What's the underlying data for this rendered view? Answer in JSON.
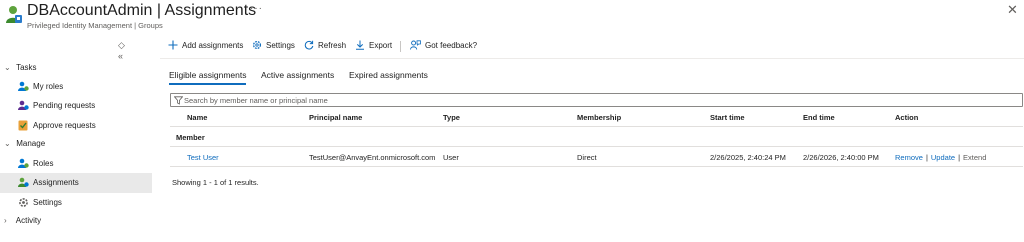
{
  "header": {
    "title": "DBAccountAdmin | Assignments",
    "subtitle": "Privileged Identity Management | Groups",
    "more": "···",
    "close": "✕"
  },
  "sidebar": {
    "controls": {
      "updown": "◇",
      "collapse": "«"
    },
    "groups": [
      {
        "label": "Tasks",
        "expanded": true
      },
      {
        "label": "Manage",
        "expanded": true
      },
      {
        "label": "Activity",
        "expanded": false
      }
    ],
    "items": [
      {
        "label": "My roles",
        "icon": "person-roles-icon"
      },
      {
        "label": "Pending requests",
        "icon": "people-pending-icon"
      },
      {
        "label": "Approve requests",
        "icon": "approve-check-icon"
      },
      {
        "label": "Roles",
        "icon": "people-roles-icon"
      },
      {
        "label": "Assignments",
        "icon": "people-assignments-icon",
        "active": true
      },
      {
        "label": "Settings",
        "icon": "gear-icon"
      }
    ]
  },
  "toolbar": {
    "add": "Add assignments",
    "settings": "Settings",
    "refresh": "Refresh",
    "export": "Export",
    "feedback": "Got feedback?"
  },
  "tabs": [
    {
      "label": "Eligible assignments",
      "active": true
    },
    {
      "label": "Active assignments",
      "active": false
    },
    {
      "label": "Expired assignments",
      "active": false
    }
  ],
  "search": {
    "placeholder": "Search by member name or principal name",
    "value": ""
  },
  "table": {
    "columns": [
      "Name",
      "Principal name",
      "Type",
      "Membership",
      "Start time",
      "End time",
      "Action"
    ],
    "group": "Member",
    "rows": [
      {
        "name": "Test User",
        "principal": "TestUser@AnvayEnt.onmicrosoft.com",
        "type": "User",
        "membership": "Direct",
        "start": "2/26/2025, 2:40:24 PM",
        "end": "2/26/2026, 2:40:00 PM",
        "actions": [
          "Remove",
          "Update",
          "Extend"
        ]
      }
    ]
  },
  "footer": "Showing 1 - 1 of 1 results.",
  "colors": {
    "accent": "#0f6cbd",
    "selected_bg": "#e9e9e9",
    "text": "#1f1f1f",
    "muted": "#605e5c"
  }
}
